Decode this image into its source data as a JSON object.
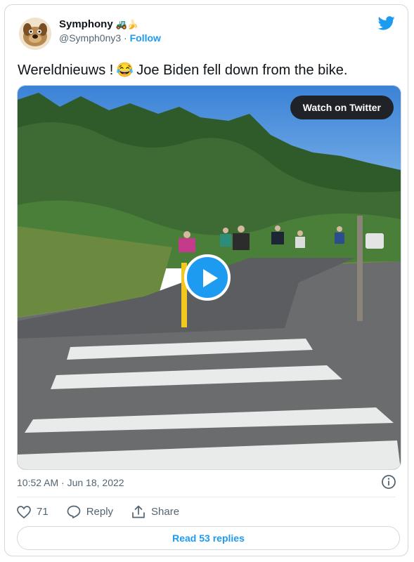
{
  "user": {
    "display_name": "Symphony",
    "name_emojis": "🚜🍌",
    "handle": "@Symph0ny3",
    "separator": "·",
    "follow_label": "Follow"
  },
  "tweet": {
    "text_before_emoji": "Wereldnieuws !",
    "emoji": "😂",
    "text_after_emoji": "Joe Biden fell down from the bike.",
    "timestamp": "10:52 AM · Jun 18, 2022"
  },
  "media": {
    "watch_label": "Watch on Twitter"
  },
  "actions": {
    "like_count": "71",
    "reply_label": "Reply",
    "share_label": "Share"
  },
  "read_replies_label": "Read 53 replies",
  "colors": {
    "accent": "#1d9bf0",
    "text": "#0f1419",
    "muted": "#536471",
    "border": "#cfd9de"
  }
}
